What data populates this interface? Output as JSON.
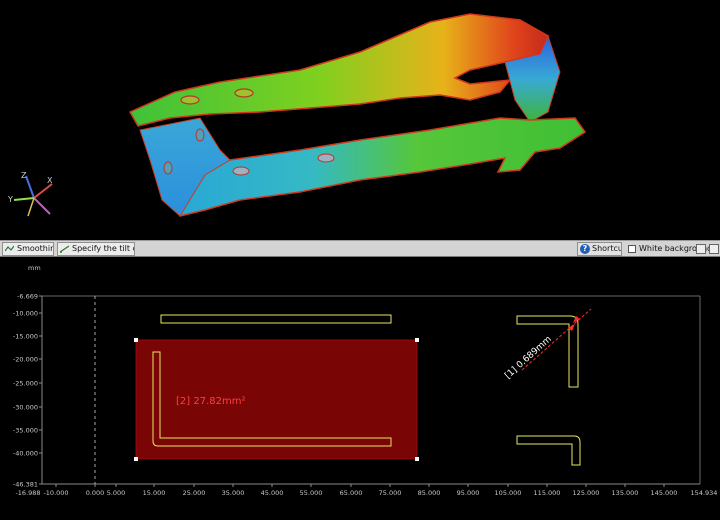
{
  "toolbar": {
    "smoothing_label": "Smoothing...",
    "tilt_label": "Specify the tilt origin...",
    "shortcuts_label": "Shortcuts",
    "white_background_label": "White background",
    "white_background_checked": false
  },
  "viewport": {
    "axis_labels": {
      "x": "X",
      "y": "Y",
      "z": "Z"
    }
  },
  "plot": {
    "unit": "mm",
    "y_ticks": [
      "-6.669",
      "-10.000",
      "-15.000",
      "-20.000",
      "-25.000",
      "-30.000",
      "-35.000",
      "-40.000",
      "-46.381"
    ],
    "x_ticks": [
      "-16.988",
      "-10.000",
      "0.000",
      "5.000",
      "15.000",
      "25.000",
      "35.000",
      "45.000",
      "55.000",
      "65.000",
      "75.000",
      "85.000",
      "95.000",
      "105.000",
      "115.000",
      "125.000",
      "135.000",
      "145.000",
      "154.934"
    ],
    "area_measurement": "[2] 27.82mm²",
    "distance_measurement": "[1] 0.689mm"
  },
  "colors": {
    "area_fill": "#7a0505",
    "profile_stroke": "#e8e860",
    "measure_red": "#ff2a2a"
  }
}
